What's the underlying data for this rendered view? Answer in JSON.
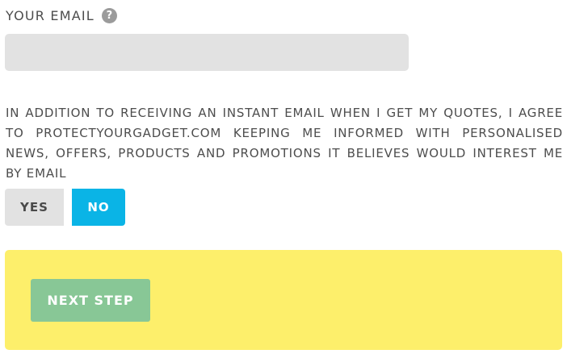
{
  "email": {
    "label": "YOUR EMAIL",
    "help_icon": "?",
    "value": "",
    "placeholder": ""
  },
  "consent": {
    "text": "IN ADDITION TO RECEIVING AN INSTANT EMAIL WHEN I GET MY QUOTES, I AGREE TO PROTECTYOURGADGET.COM KEEPING ME INFORMED WITH PERSONALISED NEWS, OFFERS, PRODUCTS AND PROMOTIONS IT BELIEVES WOULD INTEREST ME BY EMAIL",
    "yes_label": "YES",
    "no_label": "NO",
    "selected": "NO"
  },
  "actions": {
    "next_label": "NEXT STEP"
  },
  "colors": {
    "selected_toggle": "#0ab4e6",
    "unselected_toggle": "#e2e2e2",
    "panel_background": "#fdef6b",
    "next_button": "#88c796"
  },
  "icons": {
    "help": "question-circle-icon"
  }
}
